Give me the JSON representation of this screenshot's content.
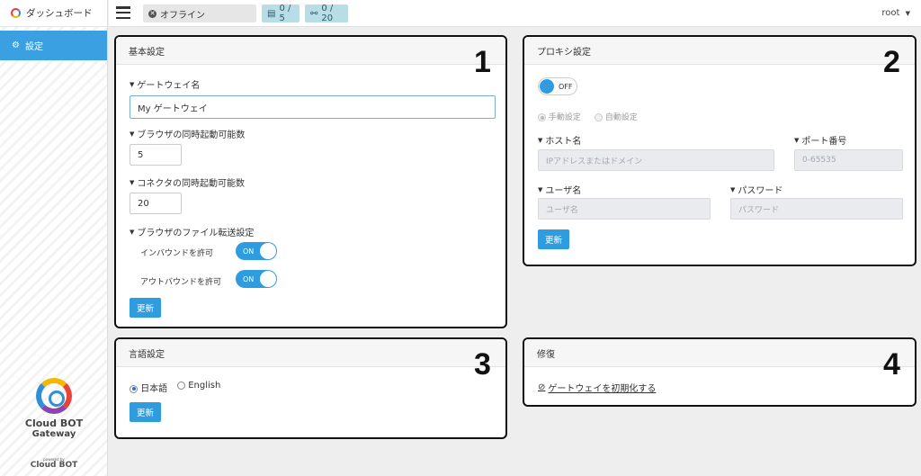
{
  "brand": {
    "title": "ダッシュボード"
  },
  "sidebar": {
    "items": [
      {
        "label": "設定"
      }
    ]
  },
  "logo": {
    "line1": "Cloud BOT",
    "line2": "Gateway",
    "powered_small": "powered by",
    "powered": "Cloud BOT"
  },
  "topbar": {
    "status": "オフライン",
    "browser_count": "0 / 5",
    "connector_count": "0 / 20",
    "user": "root"
  },
  "basic": {
    "title": "基本設定",
    "number": "1",
    "gateway_name_label": "ゲートウェイ名",
    "gateway_name_value": "My ゲートウェイ",
    "browser_label": "ブラウザの同時起動可能数",
    "browser_value": "5",
    "connector_label": "コネクタの同時起動可能数",
    "connector_value": "20",
    "transfer_label": "ブラウザのファイル転送設定",
    "inbound_label": "インバウンドを許可",
    "inbound_state": "ON",
    "outbound_label": "アウトバウンドを許可",
    "outbound_state": "ON",
    "update": "更新"
  },
  "proxy": {
    "title": "プロキシ設定",
    "number": "2",
    "toggle_state": "OFF",
    "manual": "手動設定",
    "auto": "自動設定",
    "host_label": "ホスト名",
    "host_placeholder": "IPアドレスまたはドメイン",
    "port_label": "ポート番号",
    "port_placeholder": "0-65535",
    "user_label": "ユーザ名",
    "user_placeholder": "ユーザ名",
    "pass_label": "パスワード",
    "pass_placeholder": "パスワード",
    "update": "更新"
  },
  "lang": {
    "title": "言語設定",
    "number": "3",
    "ja": "日本語",
    "en": "English",
    "update": "更新"
  },
  "repair": {
    "title": "修復",
    "number": "4",
    "reset_link": "ゲートウェイを初期化する"
  }
}
